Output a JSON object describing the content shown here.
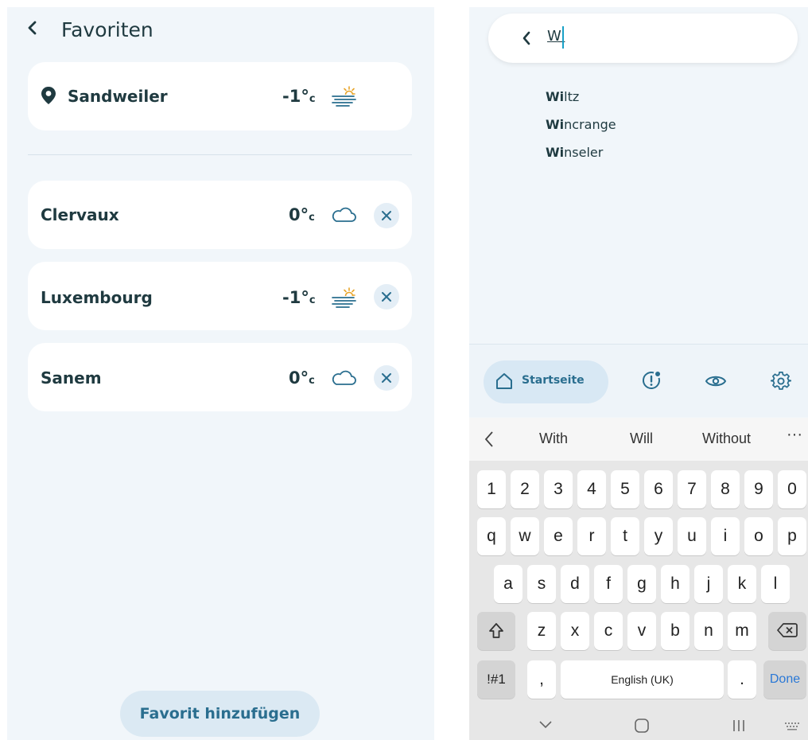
{
  "left": {
    "title": "Favoriten",
    "current_location": {
      "name": "Sandweiler",
      "temp": "-1°",
      "unit": "c",
      "icon": "fog-sun-icon"
    },
    "favorites": [
      {
        "name": "Clervaux",
        "temp": "0°",
        "unit": "c",
        "icon": "cloud-icon"
      },
      {
        "name": "Luxembourg",
        "temp": "-1°",
        "unit": "c",
        "icon": "fog-sun-icon"
      },
      {
        "name": "Sanem",
        "temp": "0°",
        "unit": "c",
        "icon": "cloud-icon"
      }
    ],
    "add_button": "Favorit hinzufügen"
  },
  "right": {
    "search": {
      "query": "Wi"
    },
    "suggestions": [
      {
        "match": "Wi",
        "rest": "ltz"
      },
      {
        "match": "Wi",
        "rest": "ncrange"
      },
      {
        "match": "Wi",
        "rest": "nseler"
      }
    ],
    "bottom_nav": {
      "home_label": "Startseite",
      "icons": [
        "alert-icon",
        "eye-icon",
        "gear-icon"
      ]
    },
    "keyboard": {
      "predictions": [
        "With",
        "Will",
        "Without"
      ],
      "more": "···",
      "row_numbers": [
        "1",
        "2",
        "3",
        "4",
        "5",
        "6",
        "7",
        "8",
        "9",
        "0"
      ],
      "row1": [
        "q",
        "w",
        "e",
        "r",
        "t",
        "y",
        "u",
        "i",
        "o",
        "p"
      ],
      "row2": [
        "a",
        "s",
        "d",
        "f",
        "g",
        "h",
        "j",
        "k",
        "l"
      ],
      "row3": [
        "z",
        "x",
        "c",
        "v",
        "b",
        "n",
        "m"
      ],
      "symbols_key": "!#1",
      "comma_key": ",",
      "space_label": "English (UK)",
      "period_key": ".",
      "done_label": "Done"
    }
  },
  "colors": {
    "accent": "#2a6e8f",
    "text": "#1f3a40",
    "background": "#f1f6fa",
    "sun": "#e8a52a"
  }
}
